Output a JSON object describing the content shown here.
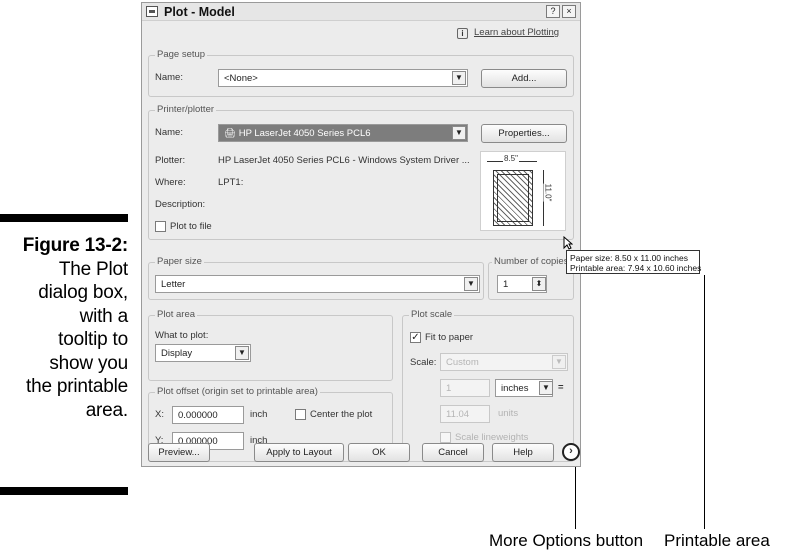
{
  "caption": {
    "figure": "Figure 13-2:",
    "lines": [
      "The Plot",
      "dialog box,",
      "with a",
      "tooltip to",
      "show you",
      "the printable",
      "area."
    ]
  },
  "dialog": {
    "title": "Plot - Model",
    "help_btn": "?",
    "close_btn": "×",
    "learn_link": "Learn about Plotting",
    "page_setup": {
      "legend": "Page setup",
      "name_label": "Name:",
      "name_value": "<None>",
      "add_button": "Add..."
    },
    "printer": {
      "legend": "Printer/plotter",
      "name_label": "Name:",
      "name_value": "HP LaserJet 4050 Series PCL6",
      "properties_button": "Properties...",
      "plotter_label": "Plotter:",
      "plotter_value": "HP LaserJet 4050 Series PCL6 - Windows System Driver ...",
      "where_label": "Where:",
      "where_value": "LPT1:",
      "description_label": "Description:",
      "plot_to_file": "Plot to file",
      "preview_width": "8.5\"",
      "preview_height": "11.0\""
    },
    "paper_size": {
      "legend": "Paper size",
      "value": "Letter"
    },
    "copies": {
      "legend": "Number of copies",
      "value": "1"
    },
    "plot_area": {
      "legend": "Plot area",
      "what_label": "What to plot:",
      "what_value": "Display"
    },
    "plot_offset": {
      "legend": "Plot offset (origin set to printable area)",
      "x_label": "X:",
      "x_value": "0.000000",
      "x_unit": "inch",
      "y_label": "Y:",
      "y_value": "0.000000",
      "y_unit": "inch",
      "center": "Center the plot"
    },
    "plot_scale": {
      "legend": "Plot scale",
      "fit": "Fit to paper",
      "scale_label": "Scale:",
      "scale_value": "Custom",
      "top_value": "1",
      "top_unit": "inches",
      "equals": "=",
      "bottom_value": "11.04",
      "bottom_unit": "units",
      "lineweights": "Scale lineweights"
    },
    "buttons": {
      "preview": "Preview...",
      "apply": "Apply to Layout",
      "ok": "OK",
      "cancel": "Cancel",
      "help": "Help"
    }
  },
  "tooltip": {
    "line1": "Paper size:  8.50 x 11.00 inches",
    "line2": "Printable area:  7.94 x 10.60 inches"
  },
  "callouts": {
    "more_options": "More Options button",
    "printable_area": "Printable area"
  }
}
